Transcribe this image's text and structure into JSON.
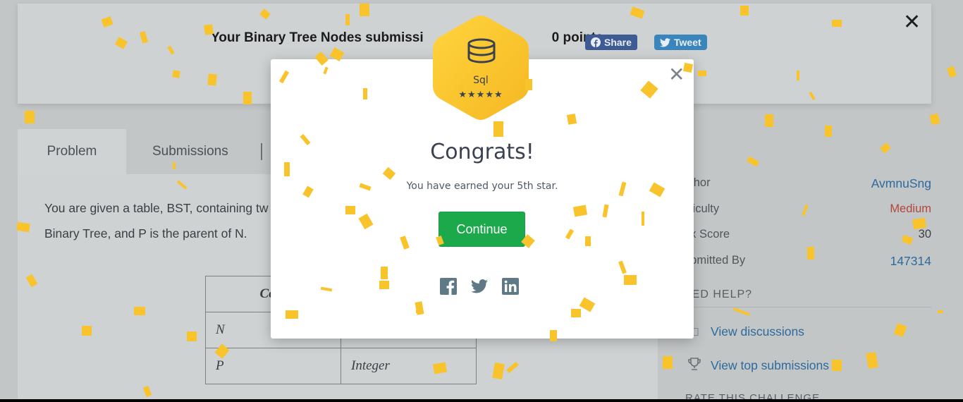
{
  "banner": {
    "text_prefix": "Your Binary Tree Nodes submissi",
    "text_suffix": "0 points.",
    "share_label": "Share",
    "tweet_label": "Tweet"
  },
  "tabs": [
    "Problem",
    "Submissions"
  ],
  "problem": {
    "line1": "You are given a table, BST, containing tw",
    "line2": "Binary Tree, and P is the parent of N."
  },
  "schema_table": {
    "header": "Colu",
    "rows": [
      {
        "col1": "N",
        "col2": ""
      },
      {
        "col1": "P",
        "col2": "Integer"
      }
    ]
  },
  "sidebar": {
    "rows": [
      {
        "label": "uthor",
        "value": "AvmnuSng"
      },
      {
        "label": "ifficulty",
        "value": "Medium"
      },
      {
        "label": "ax Score",
        "value": "30"
      },
      {
        "label": "ubmitted By",
        "value": "147314"
      }
    ],
    "need_help": "EED HELP?",
    "links": [
      "View discussions",
      "View top submissions"
    ],
    "rate_heading": "RATE THIS CHALLENGE"
  },
  "modal": {
    "badge_label": "Sql",
    "badge_stars": "★★★★★",
    "title": "Congrats!",
    "subtitle": "You have earned your 5th star.",
    "continue_label": "Continue"
  },
  "colors": {
    "accent_green": "#1ba94c",
    "badge_gold": "#f8c32b",
    "link_blue": "#2d6a9d",
    "difficulty_red": "#b3463b"
  }
}
